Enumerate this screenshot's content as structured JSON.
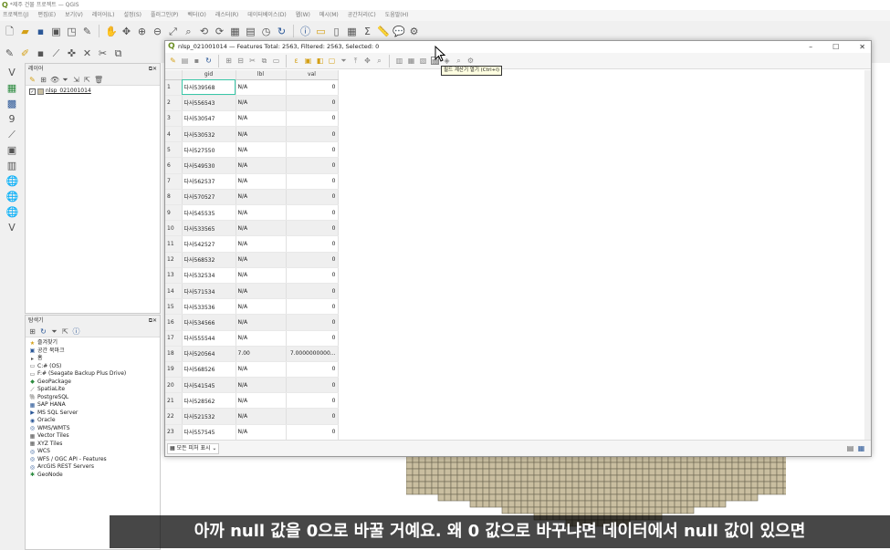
{
  "app": {
    "title": "*제주 건물 프로젝트 — QGIS"
  },
  "menu": [
    "프로젝트(J)",
    "편집(E)",
    "보기(V)",
    "레이어(L)",
    "설정(S)",
    "플러그인(P)",
    "벡터(O)",
    "래스터(R)",
    "데이터베이스(D)",
    "웹(W)",
    "메시(M)",
    "공간처리(C)",
    "도움말(H)"
  ],
  "layers_panel": {
    "title": "레이어",
    "layer_name": "nlsp_021001014"
  },
  "browser_panel": {
    "title": "탐색기",
    "items": [
      "즐겨찾기",
      "공간 북마크",
      "홈",
      "C:# (OS)",
      "F:# (Seagate Backup Plus Drive)",
      "GeoPackage",
      "SpatiaLite",
      "PostgreSQL",
      "SAP HANA",
      "MS SQL Server",
      "Oracle",
      "WMS/WMTS",
      "Vector Tiles",
      "XYZ Tiles",
      "WCS",
      "WFS / OGC API - Features",
      "ArcGIS REST Servers",
      "GeoNode"
    ]
  },
  "attr_table": {
    "title": "nlsp_021001014 — Features Total: 2563, Filtered: 2563, Selected: 0",
    "tooltip": "필드 계산기 열기 (Ctrl+I)",
    "columns": [
      "gid",
      "lbl",
      "val"
    ],
    "rows": [
      [
        "1",
        "다사539568",
        "N/A",
        "0"
      ],
      [
        "2",
        "다사556543",
        "N/A",
        "0"
      ],
      [
        "3",
        "다사530547",
        "N/A",
        "0"
      ],
      [
        "4",
        "다사530532",
        "N/A",
        "0"
      ],
      [
        "5",
        "다사527550",
        "N/A",
        "0"
      ],
      [
        "6",
        "다사549530",
        "N/A",
        "0"
      ],
      [
        "7",
        "다사562537",
        "N/A",
        "0"
      ],
      [
        "8",
        "다사570527",
        "N/A",
        "0"
      ],
      [
        "9",
        "다사545535",
        "N/A",
        "0"
      ],
      [
        "10",
        "다사533565",
        "N/A",
        "0"
      ],
      [
        "11",
        "다사542527",
        "N/A",
        "0"
      ],
      [
        "12",
        "다사568532",
        "N/A",
        "0"
      ],
      [
        "13",
        "다사532534",
        "N/A",
        "0"
      ],
      [
        "14",
        "다사571534",
        "N/A",
        "0"
      ],
      [
        "15",
        "다사533536",
        "N/A",
        "0"
      ],
      [
        "16",
        "다사534566",
        "N/A",
        "0"
      ],
      [
        "17",
        "다사555544",
        "N/A",
        "0"
      ],
      [
        "18",
        "다사520564",
        "7.00",
        "7.0000000000..."
      ],
      [
        "19",
        "다사568526",
        "N/A",
        "0"
      ],
      [
        "20",
        "다사541545",
        "N/A",
        "0"
      ],
      [
        "21",
        "다사528562",
        "N/A",
        "0"
      ],
      [
        "22",
        "다사521532",
        "N/A",
        "0"
      ],
      [
        "23",
        "다사557545",
        "N/A",
        "0"
      ]
    ],
    "show_all": "모든 피처 표시"
  },
  "subtitle": "아까 null 값을 0으로 바꿀 거예요. 왜 0 값으로 바꾸냐면 데이터에서 null 값이 있으면",
  "colors": {
    "accent": "#3ac7a8",
    "grid": "#c9bea0"
  }
}
